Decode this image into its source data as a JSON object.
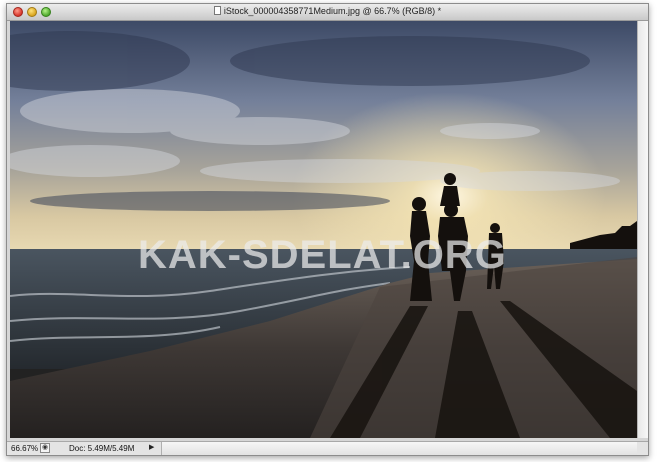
{
  "window": {
    "title": "iStock_000004358771Medium.jpg @ 66.7% (RGB/8) *"
  },
  "status": {
    "zoom": "66.67%",
    "doc_info": "Doc: 5.49M/5.49M"
  },
  "watermark": "KAK-SDELAT.ORG",
  "icons": {
    "close": "close-icon",
    "minimize": "minimize-icon",
    "zoom": "zoom-icon",
    "document": "document-icon",
    "status_menu": "triangle-right-icon"
  }
}
